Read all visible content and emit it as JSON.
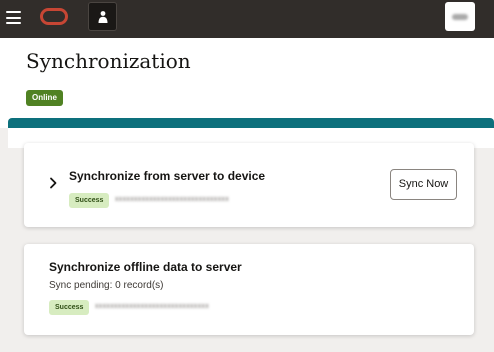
{
  "header": {
    "menu_icon": "hamburger-menu-icon",
    "logo_icon": "oracle-logo-icon",
    "user_icon": "user-icon",
    "avatar_icon": "profile-avatar-icon"
  },
  "page": {
    "title": "Synchronization",
    "status_badge": "Online"
  },
  "cards": [
    {
      "title": "Synchronize from server to device",
      "status_badge": "Success",
      "timestamp_redacted": "xxxxxxxxxxxxxxxxxxxxxxxxxxxxxx",
      "action_label": "Sync Now",
      "expand_icon": "chevron-right-icon"
    },
    {
      "title": "Synchronize offline data to server",
      "pending_text": "Sync pending: 0 record(s)",
      "status_badge": "Success",
      "timestamp_redacted": "xxxxxxxxxxxxxxxxxxxxxxxxxxxxxx"
    }
  ],
  "colors": {
    "topbar": "#312d2a",
    "brand_red": "#c74634",
    "online_green": "#508223",
    "teal_accent": "#0d707c",
    "success_bg": "#d7ecc0"
  }
}
